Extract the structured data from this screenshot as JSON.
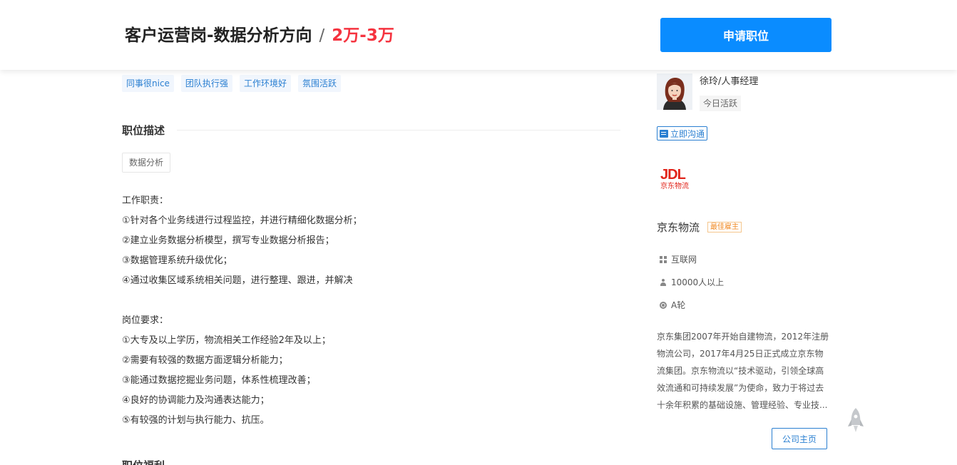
{
  "header": {
    "job_title": "客户运营岗-数据分析方向",
    "separator": "/",
    "salary": "2万-3万",
    "apply_label": "申请职位"
  },
  "tags": [
    "同事很nice",
    "团队执行强",
    "工作环境好",
    "氛围活跃"
  ],
  "description": {
    "section_title": "职位描述",
    "keyword": "数据分析",
    "duties_heading": "工作职责：",
    "duties": [
      "①针对各个业务线进行过程监控，并进行精细化数据分析；",
      "②建立业务数据分析模型，撰写专业数据分析报告；",
      "③数据管理系统升级优化；",
      "④通过收集区域系统相关问题，进行整理、跟进，并解决"
    ],
    "requirements_heading": "岗位要求：",
    "requirements": [
      "①大专及以上学历，物流相关工作经验2年及以上；",
      "②需要有较强的数据方面逻辑分析能力；",
      "③能通过数据挖掘业务问题，体系性梳理改善；",
      "④良好的协调能力及沟通表达能力；",
      "⑤有较强的计划与执行能力、抗压。"
    ],
    "next_section_title": "职位福利"
  },
  "recruiter": {
    "name_title": "徐玲/人事经理",
    "active_status": "今日活跃",
    "chat_label": "立即沟通"
  },
  "company": {
    "logo_text": "JDL",
    "logo_subtext": "京东物流",
    "name": "京东物流",
    "badge": "最佳雇主",
    "industry": "互联网",
    "size": "10000人以上",
    "stage": "A轮",
    "intro": "京东集团2007年开始自建物流，2012年注册物流公司，2017年4月25日正式成立京东物流集团。京东物流以“技术驱动，引领全球高效流通和可持续发展”为使命，致力于将过去十余年积累的基础设施、管理经验、专业技...",
    "home_label": "公司主页"
  },
  "colors": {
    "accent": "#0a8cff",
    "salary": "#f5333f",
    "link": "#2a7fd1",
    "brand_logo": "#e1251b"
  }
}
